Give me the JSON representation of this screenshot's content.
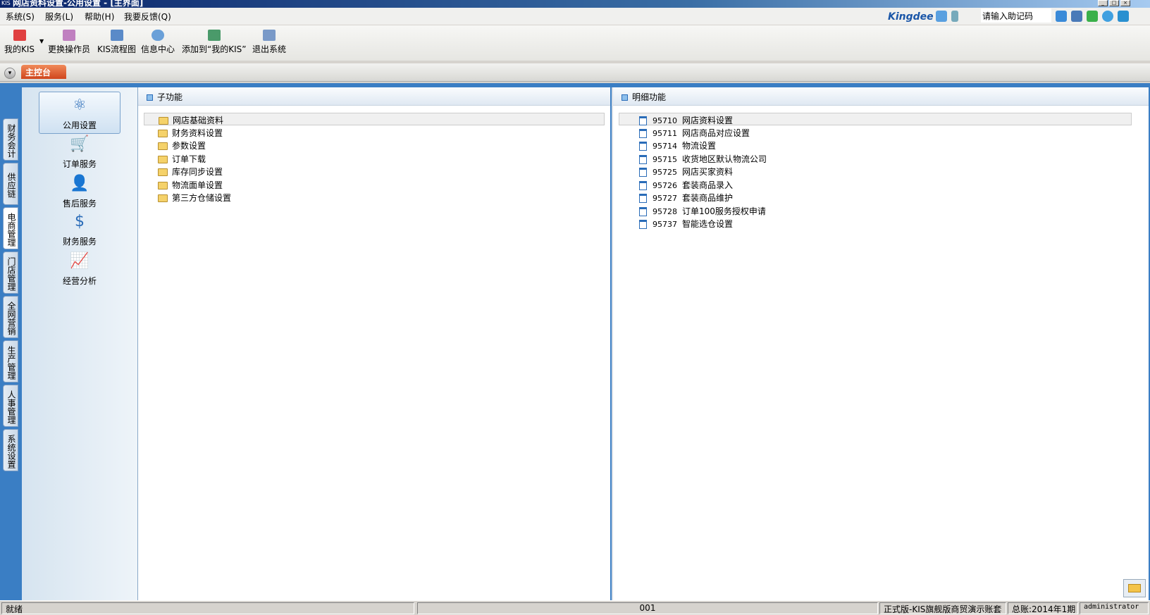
{
  "window": {
    "title": "网店资料设置-公用设置 - [主界面]",
    "logo": "KIS"
  },
  "menu": [
    "系统(S)",
    "服务(L)",
    "帮助(H)",
    "我要反馈(Q)"
  ],
  "header": {
    "brand": "Kingdee",
    "help_placeholder": "请输入助记码"
  },
  "toolbar": [
    {
      "label": "我的KIS",
      "icon": "star-icon"
    },
    {
      "label": "更换操作员",
      "icon": "users-icon"
    },
    {
      "label": "KIS流程图",
      "icon": "flowchart-icon"
    },
    {
      "label": "信息中心",
      "icon": "chat-icon"
    },
    {
      "label": "添加到“我的KIS”",
      "icon": "add-favorite-icon"
    },
    {
      "label": "退出系统",
      "icon": "exit-icon"
    }
  ],
  "tabs": {
    "main": "主控台"
  },
  "side_tabs": [
    "财务会计",
    "供应链",
    "电商管理",
    "门店管理",
    "全网营销",
    "生产管理",
    "人事管理",
    "系统设置"
  ],
  "nav": [
    {
      "label": "公用设置",
      "icon": "atom-icon"
    },
    {
      "label": "订单服务",
      "icon": "cart-icon"
    },
    {
      "label": "售后服务",
      "icon": "support-icon"
    },
    {
      "label": "财务服务",
      "icon": "cart-dollar-icon"
    },
    {
      "label": "经营分析",
      "icon": "chart-icon"
    }
  ],
  "subfunc": {
    "title": "子功能",
    "items": [
      "网店基础资料",
      "财务资料设置",
      "参数设置",
      "订单下载",
      "库存同步设置",
      "物流面单设置",
      "第三方仓储设置"
    ]
  },
  "detail": {
    "title": "明细功能",
    "items": [
      {
        "code": "95710",
        "label": "网店资料设置"
      },
      {
        "code": "95711",
        "label": "网店商品对应设置"
      },
      {
        "code": "95714",
        "label": "物流设置"
      },
      {
        "code": "95715",
        "label": "收货地区默认物流公司"
      },
      {
        "code": "95725",
        "label": "网店买家资料"
      },
      {
        "code": "95726",
        "label": "套装商品录入"
      },
      {
        "code": "95727",
        "label": "套装商品维护"
      },
      {
        "code": "95728",
        "label": "订单100服务授权申请"
      },
      {
        "code": "95737",
        "label": "智能选仓设置"
      }
    ]
  },
  "status": {
    "ready": "就绪",
    "code": "001",
    "edition": "正式版-KIS旗舰版商贸演示账套",
    "period": "总账:2014年1期",
    "user": "administrator"
  }
}
